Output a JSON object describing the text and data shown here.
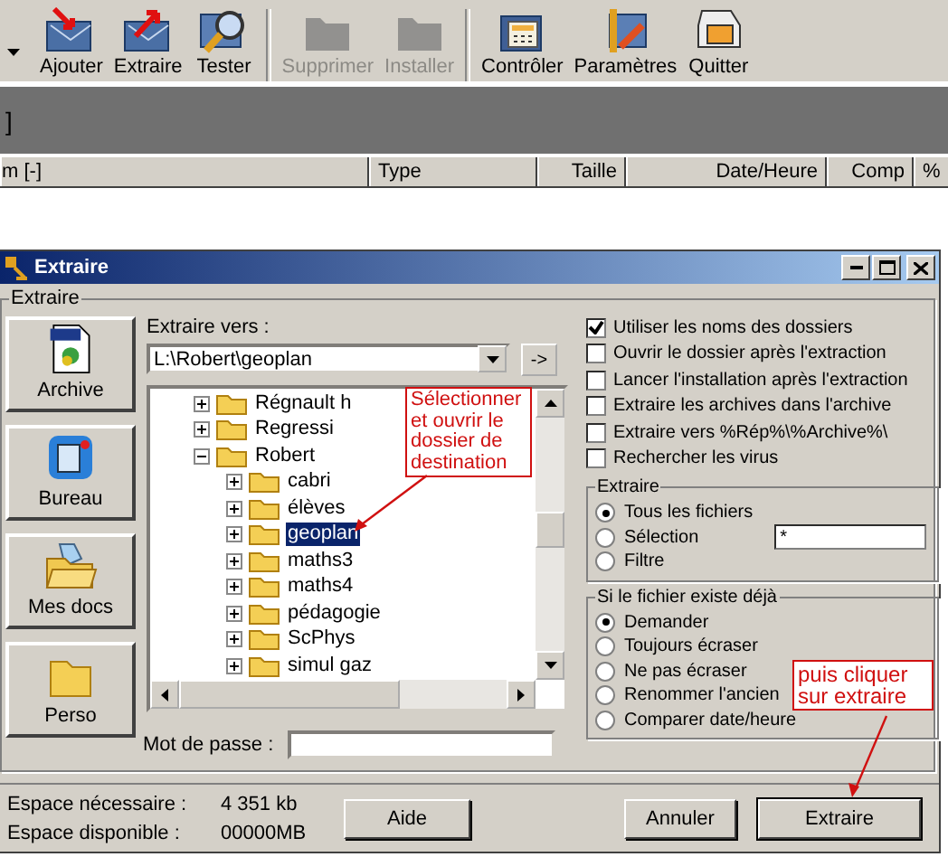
{
  "toolbar": {
    "buttons": [
      {
        "label": "Ajouter",
        "kind": "add",
        "disabled": false
      },
      {
        "label": "Extraire",
        "kind": "extract",
        "disabled": false
      },
      {
        "label": "Tester",
        "kind": "test",
        "disabled": false
      },
      {
        "label": "Supprimer",
        "kind": "delete",
        "disabled": true
      },
      {
        "label": "Installer",
        "kind": "install",
        "disabled": true
      },
      {
        "label": "Contrôler",
        "kind": "check",
        "disabled": false
      },
      {
        "label": "Paramètres",
        "kind": "settings",
        "disabled": false
      },
      {
        "label": "Quitter",
        "kind": "quit",
        "disabled": false
      }
    ]
  },
  "address_bar": {
    "text": "]"
  },
  "file_list": {
    "columns": [
      "m [-]",
      "Type",
      "Taille",
      "Date/Heure",
      "Comp",
      "%"
    ]
  },
  "dialog": {
    "title": "Extraire",
    "group_label": "Extraire",
    "shortcuts": [
      {
        "label": "Archive",
        "kind": "zip"
      },
      {
        "label": "Bureau",
        "kind": "desktop"
      },
      {
        "label": "Mes docs",
        "kind": "docs"
      },
      {
        "label": "Perso",
        "kind": "folder"
      }
    ],
    "destination": {
      "label": "Extraire vers :",
      "value": "L:\\Robert\\geoplan",
      "go_button": "->"
    },
    "tree": [
      {
        "label": "Régnault h",
        "expanded": false,
        "selected": false
      },
      {
        "label": "Regressi",
        "expanded": false,
        "selected": false
      },
      {
        "label": "Robert",
        "expanded": true,
        "selected": false,
        "children": [
          {
            "label": "cabri",
            "expanded": false,
            "selected": false
          },
          {
            "label": "élèves",
            "expanded": false,
            "selected": false
          },
          {
            "label": "geoplan",
            "expanded": false,
            "selected": true
          },
          {
            "label": "maths3",
            "expanded": false,
            "selected": false
          },
          {
            "label": "maths4",
            "expanded": false,
            "selected": false
          },
          {
            "label": "pédagogie",
            "expanded": false,
            "selected": false
          },
          {
            "label": "ScPhys",
            "expanded": false,
            "selected": false
          },
          {
            "label": "simul gaz",
            "expanded": false,
            "selected": false
          }
        ]
      }
    ],
    "password": {
      "label": "Mot de passe :"
    },
    "options": [
      {
        "label": "Utiliser les noms des dossiers",
        "checked": true
      },
      {
        "label": "Ouvrir le dossier après l'extraction",
        "checked": false
      },
      {
        "label": "Lancer l'installation après l'extraction",
        "checked": false
      },
      {
        "label": "Extraire les archives dans l'archive",
        "checked": false
      },
      {
        "label": "Extraire vers %Rép%\\%Archive%\\",
        "checked": false
      },
      {
        "label": "Rechercher les virus",
        "checked": false
      }
    ],
    "extract_group": {
      "title": "Extraire",
      "filter_value": "*",
      "options": [
        {
          "label": "Tous les fichiers",
          "selected": true
        },
        {
          "label": "Sélection",
          "selected": false
        },
        {
          "label": "Filtre",
          "selected": false
        }
      ]
    },
    "overwrite_group": {
      "title": "Si le fichier existe déjà",
      "options": [
        {
          "label": "Demander",
          "selected": true
        },
        {
          "label": "Toujours écraser",
          "selected": false
        },
        {
          "label": "Ne pas écraser",
          "selected": false
        },
        {
          "label": "Renommer l'ancien",
          "selected": false
        },
        {
          "label": "Comparer date/heure",
          "selected": false
        }
      ]
    },
    "space": [
      {
        "label": "Espace nécessaire :",
        "value": "4 351 kb"
      },
      {
        "label": "Espace disponible :",
        "value": "00000MB"
      }
    ],
    "help_button": "Aide",
    "cancel_button": "Annuler",
    "ok_button": "Extraire"
  },
  "annotations": [
    {
      "text": "Sélectionner et ouvrir le dossier de destination"
    },
    {
      "text": "puis cliquer sur extraire"
    }
  ]
}
